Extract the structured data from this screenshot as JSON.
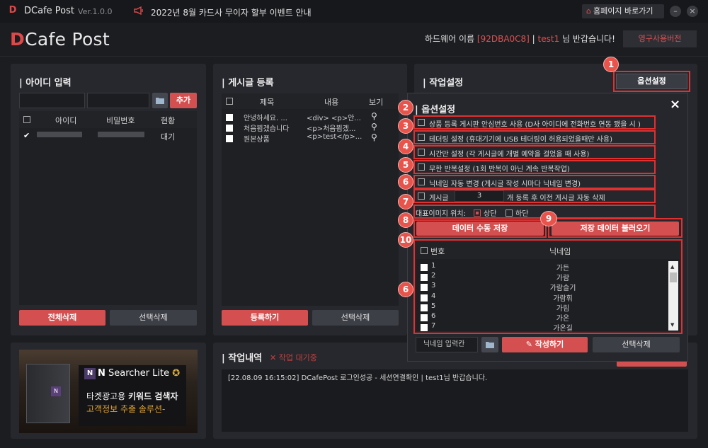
{
  "app": {
    "logo_char": "D",
    "title": "DCafe Post",
    "version": "Ver.1.0.0"
  },
  "notice": {
    "icon": "megaphone-icon",
    "text": "2022년 8월 카드사 무이자 할부 이벤트 안내"
  },
  "titlebar": {
    "home_label": "홈페이지 바로가기",
    "minimize": "–",
    "close": "×"
  },
  "header": {
    "logo_d": "D",
    "logo_rest": "Cafe Post",
    "hw_prefix": "하드웨어 이름",
    "hw_id": "[92DBA0C8]",
    "separator": " | ",
    "user": "test1",
    "greeting": " 님 반갑습니다!",
    "perm_button": "영구사용버전"
  },
  "id_panel": {
    "title": "| 아이디 입력",
    "add_button": "추가",
    "columns": [
      "아이디",
      "비밀번호",
      "현황"
    ],
    "rows": [
      {
        "status": "대기",
        "checked": true
      }
    ],
    "delete_all": "전체삭제",
    "delete_selected": "선택삭제"
  },
  "post_panel": {
    "title": "| 게시글 등록",
    "columns": [
      "제목",
      "내용",
      "보기"
    ],
    "rows": [
      {
        "title": "안녕하세요. ...",
        "content": "<div> <p>안..."
      },
      {
        "title": "처음뵙겠습니다",
        "content": "<p>처음뵙겠..."
      },
      {
        "title": "원본상품",
        "content": "<p>test</p>..."
      }
    ],
    "register": "등록하기",
    "delete_selected": "선택삭제"
  },
  "work_panel": {
    "title": "| 작업설정",
    "option_button": "옵션설정"
  },
  "option_dialog": {
    "title": "| 옵션설정",
    "close": "×",
    "options": [
      "상품 등록 게시판 안심번호 사용 (D사 아이디에 전화번호 연동 됐을 시 )",
      "테더링 설정 (휴대기기에 USB 테더링이 허용되었을때만 사용)",
      "시간만 설정 (각 게시글에 개별 예약을 걸었을 때 사용)",
      "무한 반복설정 (1회 반복이 아닌 계속 반복작업)",
      "닉네임 자동 변경 (게시글 작성 시마다 닉네임 변경)"
    ],
    "delete_prefix": "게시글",
    "delete_count": "3",
    "delete_suffix": "개 등록 후 이전 게시글 자동 삭제",
    "image_pos_label": "대표이미지 위치:",
    "image_pos_top": "상단",
    "image_pos_bottom": "하단",
    "save_manual": "데이터 수동 저장",
    "load_saved": "저장 데이터 불러오기",
    "nick_columns": [
      "번호",
      "닉네임"
    ],
    "nicknames": [
      {
        "no": "1",
        "name": "가든"
      },
      {
        "no": "2",
        "name": "가람"
      },
      {
        "no": "3",
        "name": "가람슬기"
      },
      {
        "no": "4",
        "name": "가람휘"
      },
      {
        "no": "5",
        "name": "가림"
      },
      {
        "no": "6",
        "name": "가온"
      },
      {
        "no": "7",
        "name": "가온길"
      }
    ],
    "nick_input_placeholder": "닉네임 입력칸",
    "write_button": "작성하기",
    "delete_selected": "선택삭제"
  },
  "callouts": [
    "1",
    "2",
    "3",
    "4",
    "5",
    "6",
    "7",
    "8",
    "9",
    "10",
    "6"
  ],
  "ad": {
    "brand_n": "N",
    "brand_rest": "Searcher Lite",
    "line1_pre": "타겟광고용 ",
    "line1_bold": "키워드 검색자",
    "line2": "고객정보 추출 솔루션-"
  },
  "log_panel": {
    "title": "| 작업내역",
    "status": "✕ 작업 대기중",
    "entries": [
      "[22.08.09 16:15:02]  DCafePost 로그인성공 - 세션연결확인  | test1님 반갑습니다."
    ]
  },
  "colors": {
    "accent": "#d45050",
    "callout": "#e8544c",
    "highlight_border": "#e03030",
    "bg": "#1c1d21",
    "panel": "#27282d"
  }
}
